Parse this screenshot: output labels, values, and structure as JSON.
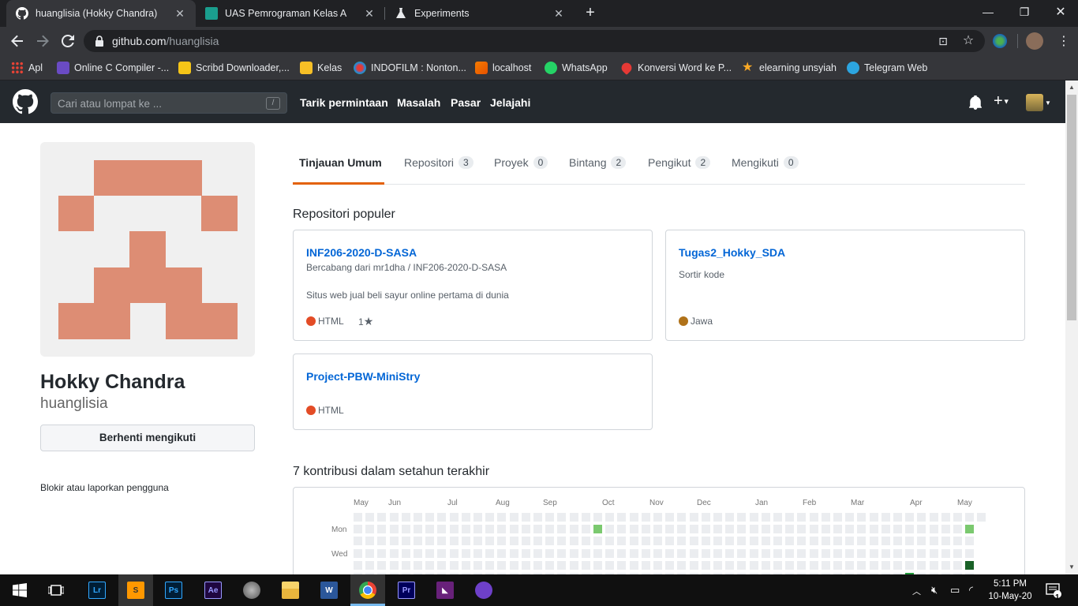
{
  "browser": {
    "tabs": [
      {
        "title": "huanglisia (Hokky Chandra)",
        "active": true
      },
      {
        "title": "UAS Pemrograman Kelas A",
        "active": false
      },
      {
        "title": "Experiments",
        "active": false
      }
    ],
    "url_host": "github.com",
    "url_path": "/huanglisia",
    "bookmarks": [
      "Apl",
      "Online C Compiler -...",
      "Scribd Downloader,...",
      "Kelas",
      "INDOFILM : Nonton...",
      "localhost",
      "WhatsApp",
      "Konversi Word ke P...",
      "elearning unsyiah",
      "Telegram Web"
    ]
  },
  "github_header": {
    "search_placeholder": "Cari atau lompat ke ...",
    "search_shortcut": "/",
    "nav": [
      "Tarik permintaan",
      "Masalah",
      "Pasar",
      "Jelajahi"
    ]
  },
  "profile": {
    "full_name": "Hokky Chandra",
    "username": "huanglisia",
    "unfollow_label": "Berhenti mengikuti",
    "block_label": "Blokir atau laporkan pengguna",
    "avatar_color": "#dd8d74"
  },
  "tabs": [
    {
      "label": "Tinjauan Umum",
      "count": ""
    },
    {
      "label": "Repositori",
      "count": "3"
    },
    {
      "label": "Proyek",
      "count": "0"
    },
    {
      "label": "Bintang",
      "count": "2"
    },
    {
      "label": "Pengikut",
      "count": "2"
    },
    {
      "label": "Mengikuti",
      "count": "0"
    }
  ],
  "popular_title": "Repositori populer",
  "repos": [
    {
      "name": "INF206-2020-D-SASA",
      "forked_from": "Bercabang dari mr1dha / INF206-2020-D-SASA",
      "description": "Situs web jual beli sayur online pertama di dunia",
      "language": "HTML",
      "language_color": "#e34c26",
      "stars": "1"
    },
    {
      "name": "Tugas2_Hokky_SDA",
      "forked_from": "",
      "description": "Sortir kode",
      "language": "Jawa",
      "language_color": "#b07219",
      "stars": ""
    },
    {
      "name": "Project-PBW-MiniStry",
      "forked_from": "",
      "description": "",
      "language": "HTML",
      "language_color": "#e34c26",
      "stars": ""
    }
  ],
  "contrib_title": "7 kontribusi dalam setahun terakhir",
  "contrib_months": [
    "May",
    "Jun",
    "Jul",
    "Aug",
    "Sep",
    "Oct",
    "Nov",
    "Dec",
    "Jan",
    "Feb",
    "Mar",
    "Apr",
    "May"
  ],
  "contrib_days": [
    "Mon",
    "Wed"
  ],
  "taskbar": {
    "time": "5:11 PM",
    "date": "10-May-20",
    "notification_count": "1"
  }
}
